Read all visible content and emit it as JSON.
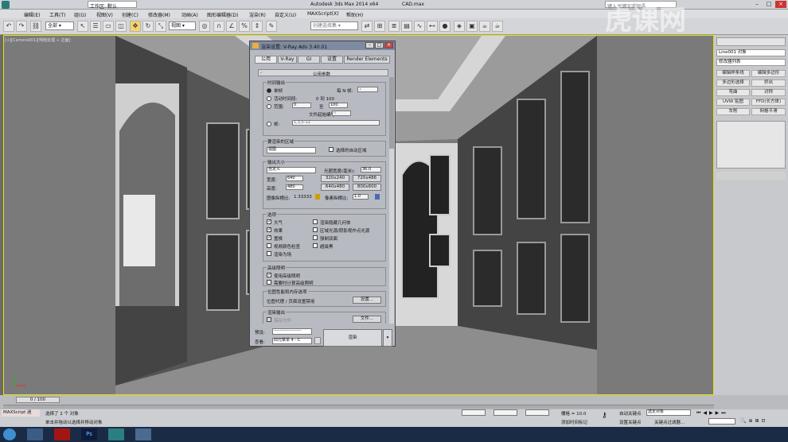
{
  "title": {
    "workspace": "工作区: 默认",
    "search_placeholder": "键入关键字或短语",
    "app": "Autodesk 3ds Max 2014 x64",
    "file": "CAD.max"
  },
  "menu": [
    "编辑(E)",
    "工具(T)",
    "组(G)",
    "视图(V)",
    "创建(C)",
    "修改器(M)",
    "动画(A)",
    "图形编辑器(D)",
    "渲染(R)",
    "自定义(U)",
    "MAXScript(X)",
    "帮助(H)"
  ],
  "toolbar": {
    "filter": "全部",
    "view": "视图",
    "selection_set": "创建选择集"
  },
  "viewport": {
    "label": "[+][Camera001][明暗处理 + 边面]"
  },
  "panel": {
    "object_name": "Line001 对象",
    "modifier_list": "修改器列表",
    "buttons": [
      "编辑样条线",
      "编辑多边形",
      "多边形选择",
      "挤出",
      "弯曲",
      "对称",
      "UVW 贴图",
      "FFD(长方体)",
      "车削",
      "网格平滑"
    ]
  },
  "dialog": {
    "title": "渲染设置: V-Ray Adv 3.40.01",
    "tabs": [
      "公用",
      "V-Ray",
      "GI",
      "设置",
      "Render Elements"
    ],
    "rollout": "公用参数",
    "time_output": {
      "title": "时间输出",
      "single": "单帧",
      "every_n": "每 N 帧:",
      "every_n_value": "1",
      "active_segment": "活动时间段:",
      "active_range": "0 到 100",
      "range": "范围:",
      "range_from": "0",
      "range_to_label": "至",
      "range_to": "100",
      "file_number": "文件起始编号:",
      "file_number_value": "0",
      "frames": "帧:",
      "frames_value": "1,3,5-12"
    },
    "area": {
      "title": "要渲染的区域",
      "select": "视图",
      "auto_region": "选择的自动区域"
    },
    "output_size": {
      "title": "输出大小",
      "preset": "自定义",
      "aperture_label": "光圈宽度(毫米):",
      "aperture": "36.0",
      "width_label": "宽度:",
      "width": "640",
      "height_label": "高度:",
      "height": "480",
      "presets": [
        "320x240",
        "720x486",
        "640x480",
        "800x600"
      ],
      "aspect_label": "图像纵横比:",
      "aspect": "1.33333",
      "pixel_aspect_label": "像素纵横比:",
      "pixel_aspect": "1.0"
    },
    "options": {
      "title": "选项",
      "items": [
        "大气",
        "渲染隐藏几何体",
        "效果",
        "区域光源/阴影视作点光源",
        "置换",
        "强制双面",
        "视频颜色检查",
        "超级黑",
        "渲染为场"
      ],
      "checked": [
        true,
        false,
        true,
        false,
        true,
        false,
        false,
        false,
        false
      ]
    },
    "advanced_lighting": {
      "title": "高级照明",
      "use": "使用高级照明",
      "compute": "需要时计算高级照明"
    },
    "bitmap": {
      "title": "位图性能和内存选项",
      "text": "位图代理 / 页面设置禁用",
      "button": "设置..."
    },
    "render_output": {
      "title": "渲染输出",
      "save_file": "保存文件",
      "files_button": "文件..."
    },
    "preset_label": "预设:",
    "preset_value": "-------------------",
    "view_label": "查看:",
    "view_value": "四元菜单 4 - C",
    "render_button": "渲染"
  },
  "timeline": {
    "frame": "0 / 100"
  },
  "status": {
    "maxscript": "MAXScript 迷",
    "selected": "选择了 2 个 对象",
    "hint": "单击并拖动以选择并移动对象",
    "grid": "栅格 = 10.0",
    "auto_key": "自动关键点",
    "selected_obj": "选定对象",
    "set_key": "设置关键点",
    "key_filters": "关键点过滤器...",
    "add_time_tag": "添加时间标记"
  },
  "watermark": "虎课网"
}
